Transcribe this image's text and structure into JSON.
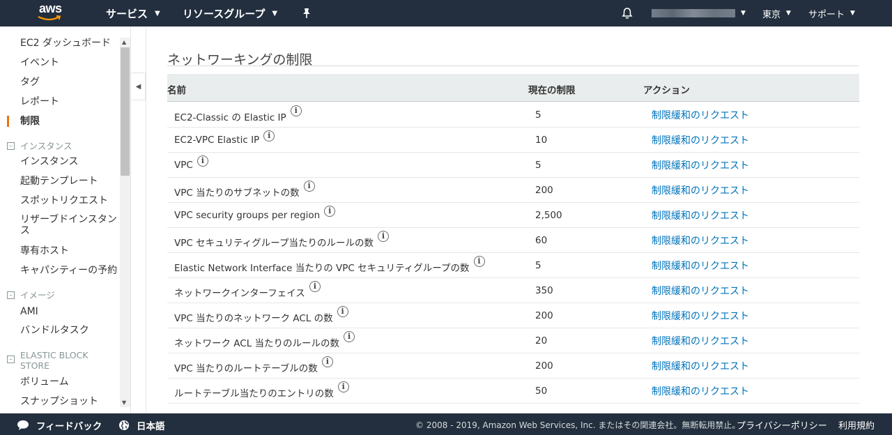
{
  "topnav": {
    "logo": "aws",
    "services": "サービス",
    "resource_groups": "リソースグループ",
    "pin_icon": "pin-icon",
    "bell_icon": "bell-icon",
    "region": "東京",
    "support": "サポート"
  },
  "sidebar": {
    "items": [
      {
        "label": "EC2 ダッシュボード"
      },
      {
        "label": "イベント"
      },
      {
        "label": "タグ"
      },
      {
        "label": "レポート"
      },
      {
        "label": "制限"
      }
    ],
    "group_instances": "インスタンス",
    "instances_items": [
      {
        "label": "インスタンス"
      },
      {
        "label": "起動テンプレート"
      },
      {
        "label": "スポットリクエスト"
      },
      {
        "label": "リザーブドインスタンス"
      },
      {
        "label": "専有ホスト"
      },
      {
        "label": "キャパシティーの予約"
      }
    ],
    "group_images": "イメージ",
    "images_items": [
      {
        "label": "AMI"
      },
      {
        "label": "バンドルタスク"
      }
    ],
    "group_ebs": "ELASTIC BLOCK STORE",
    "ebs_items": [
      {
        "label": "ボリューム"
      },
      {
        "label": "スナップショット"
      }
    ]
  },
  "main": {
    "section_title": "ネットワーキングの制限",
    "columns": {
      "name": "名前",
      "limit": "現在の制限",
      "action": "アクション"
    },
    "rows": [
      {
        "name": "EC2-Classic の Elastic IP",
        "limit": "5",
        "action": "制限緩和のリクエスト"
      },
      {
        "name": "EC2-VPC Elastic IP",
        "limit": "10",
        "action": "制限緩和のリクエスト"
      },
      {
        "name": "VPC",
        "limit": "5",
        "action": "制限緩和のリクエスト"
      },
      {
        "name": "VPC 当たりのサブネットの数",
        "limit": "200",
        "action": "制限緩和のリクエスト"
      },
      {
        "name": "VPC security groups per region",
        "limit": "2,500",
        "action": "制限緩和のリクエスト"
      },
      {
        "name": "VPC セキュリティグループ当たりのルールの数",
        "limit": "60",
        "action": "制限緩和のリクエスト"
      },
      {
        "name": "Elastic Network Interface 当たりの VPC セキュリティグループの数",
        "limit": "5",
        "action": "制限緩和のリクエスト"
      },
      {
        "name": "ネットワークインターフェイス",
        "limit": "350",
        "action": "制限緩和のリクエスト"
      },
      {
        "name": "VPC 当たりのネットワーク ACL の数",
        "limit": "200",
        "action": "制限緩和のリクエスト"
      },
      {
        "name": "ネットワーク ACL 当たりのルールの数",
        "limit": "20",
        "action": "制限緩和のリクエスト"
      },
      {
        "name": "VPC 当たりのルートテーブルの数",
        "limit": "200",
        "action": "制限緩和のリクエスト"
      },
      {
        "name": "ルートテーブル当たりのエントリの数",
        "limit": "50",
        "action": "制限緩和のリクエスト"
      }
    ]
  },
  "footer": {
    "feedback": "フィードバック",
    "language": "日本語",
    "copyright": "© 2008 - 2019, Amazon Web Services, Inc. またはその関連会社。無断転用禁止。",
    "privacy": "プライバシーポリシー",
    "terms": "利用規約"
  },
  "colors": {
    "nav_bg": "#232f3e",
    "accent": "#ec7211",
    "link": "#0073bb"
  }
}
